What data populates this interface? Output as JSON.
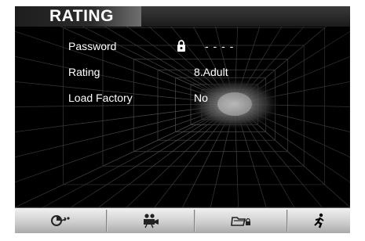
{
  "page": {
    "title": "RATING"
  },
  "settings": {
    "password": {
      "label": "Password",
      "value": "- - - -",
      "icon": "lock-icon"
    },
    "rating": {
      "label": "Rating",
      "value": "8.Adult"
    },
    "load_factory": {
      "label": "Load Factory",
      "value": "No"
    }
  },
  "menubar": {
    "items": [
      {
        "name": "general-setup",
        "icon": "gear-setup-icon"
      },
      {
        "name": "video-setup",
        "icon": "projector-icon"
      },
      {
        "name": "rating-setup",
        "icon": "folder-lock-icon",
        "active": true
      },
      {
        "name": "exit",
        "icon": "running-person-icon"
      }
    ]
  },
  "colors": {
    "text": "#ffffff",
    "menubar": "#cfcfcf",
    "background": "#000000"
  }
}
